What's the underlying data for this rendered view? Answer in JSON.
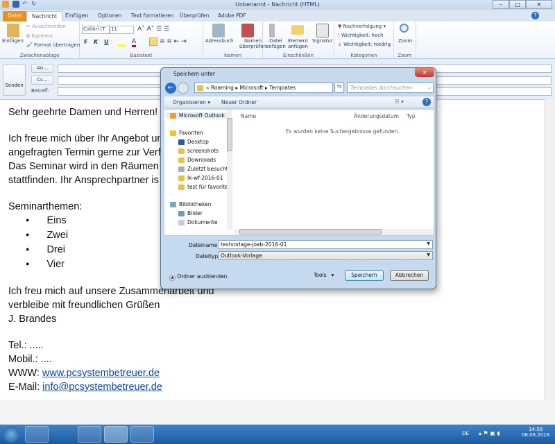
{
  "window": {
    "title": "Unbenannt - Nachricht (HTML)"
  },
  "tabs": [
    "Datei",
    "Nachricht",
    "Einfügen",
    "Optionen",
    "Text formatieren",
    "Überprüfen",
    "Adobe PDF"
  ],
  "ribbon": {
    "clipboard": {
      "label": "Zwischenablage",
      "paste": "Einfügen",
      "cut": "Ausschneiden",
      "copy": "Kopieren",
      "format": "Format übertragen"
    },
    "basictext": {
      "label": "Basistext",
      "font": "Calibri (T",
      "size": "11",
      "bold": "F",
      "italic": "K",
      "underline": "U"
    },
    "names": {
      "label": "Namen",
      "addressbook": "Adressbuch",
      "check1": "Namen",
      "check2": "überprüfen"
    },
    "include": {
      "label": "Einschließen",
      "file1": "Datei",
      "file2": "anfügen",
      "elem1": "Element",
      "elem2": "anfügen",
      "sig": "Signatur"
    },
    "categories": {
      "label": "Kategorien",
      "followup": "Nachverfolgung",
      "high": "Wichtigkeit: hoch",
      "low": "Wichtigkeit: niedrig"
    },
    "zoom": {
      "label": "Zoom",
      "btn": "Zoom"
    }
  },
  "header": {
    "send": "Senden",
    "to": "An...",
    "cc": "Cc...",
    "subject": "Betreff:"
  },
  "body": {
    "greeting": "Sehr geehrte Damen und Herren!",
    "p1": [
      "Ich freue mich über Ihr Angebot un",
      "angefragten Termin gerne zur Verf",
      "Das Seminar wird in den Räumen d",
      "stattfinden. Ihr Ansprechpartner is"
    ],
    "topics_label": "Seminarthemen:",
    "topics": [
      "Eins",
      "Zwei",
      "Drei",
      "Vier"
    ],
    "p2": [
      "Ich freu mich auf unsere Zusammenarbeit und",
      "verbleibe mit freundlichen Grüßen",
      "J. Brandes"
    ],
    "tel": "Tel.: .....",
    "mobil": "Mobil.: ....",
    "www_label": "WWW: ",
    "www": "www.pcsystembetreuer.de",
    "mail_label": "E-Mail: ",
    "mail": "info@pcsystembetreuer.de"
  },
  "dialog": {
    "title": "Speichern unter",
    "path": [
      "«",
      "Roaming",
      "Microsoft",
      "Templates"
    ],
    "search_placeholder": "Templates durchsuchen",
    "organize": "Organisieren",
    "new_folder": "Neuer Ordner",
    "nav": [
      {
        "label": "Microsoft Outlook",
        "type": "outlook"
      },
      {
        "label": "Favoriten",
        "type": "star"
      },
      {
        "label": "Desktop",
        "type": "desktop",
        "indent": true
      },
      {
        "label": "screenshots",
        "type": "folder",
        "indent": true
      },
      {
        "label": "Downloads",
        "type": "folder",
        "indent": true
      },
      {
        "label": "Zuletzt besucht",
        "type": "recent",
        "indent": true
      },
      {
        "label": "lk-wf-2016-01",
        "type": "folder",
        "indent": true
      },
      {
        "label": "test für favoriten",
        "type": "folder",
        "indent": true
      },
      {
        "label": "Bibliotheken",
        "type": "lib"
      },
      {
        "label": "Bilder",
        "type": "pic",
        "indent": true
      },
      {
        "label": "Dokumente",
        "type": "doc",
        "indent": true
      }
    ],
    "columns": [
      "Name",
      "Änderungsdatum",
      "Typ"
    ],
    "empty": "Es wurden keine Suchergebnisse gefunden.",
    "filename_label": "Dateiname:",
    "filename": "testvorlage-joeb-2016-01",
    "filetype_label": "Dateityp:",
    "filetype": "Outlook-Vorlage",
    "hide_folders": "Ordner ausblenden",
    "tools": "Tools",
    "save": "Speichern",
    "cancel": "Abbrechen"
  },
  "taskbar": {
    "lang": "DE",
    "time": "14:58",
    "date": "06.06.2016"
  }
}
